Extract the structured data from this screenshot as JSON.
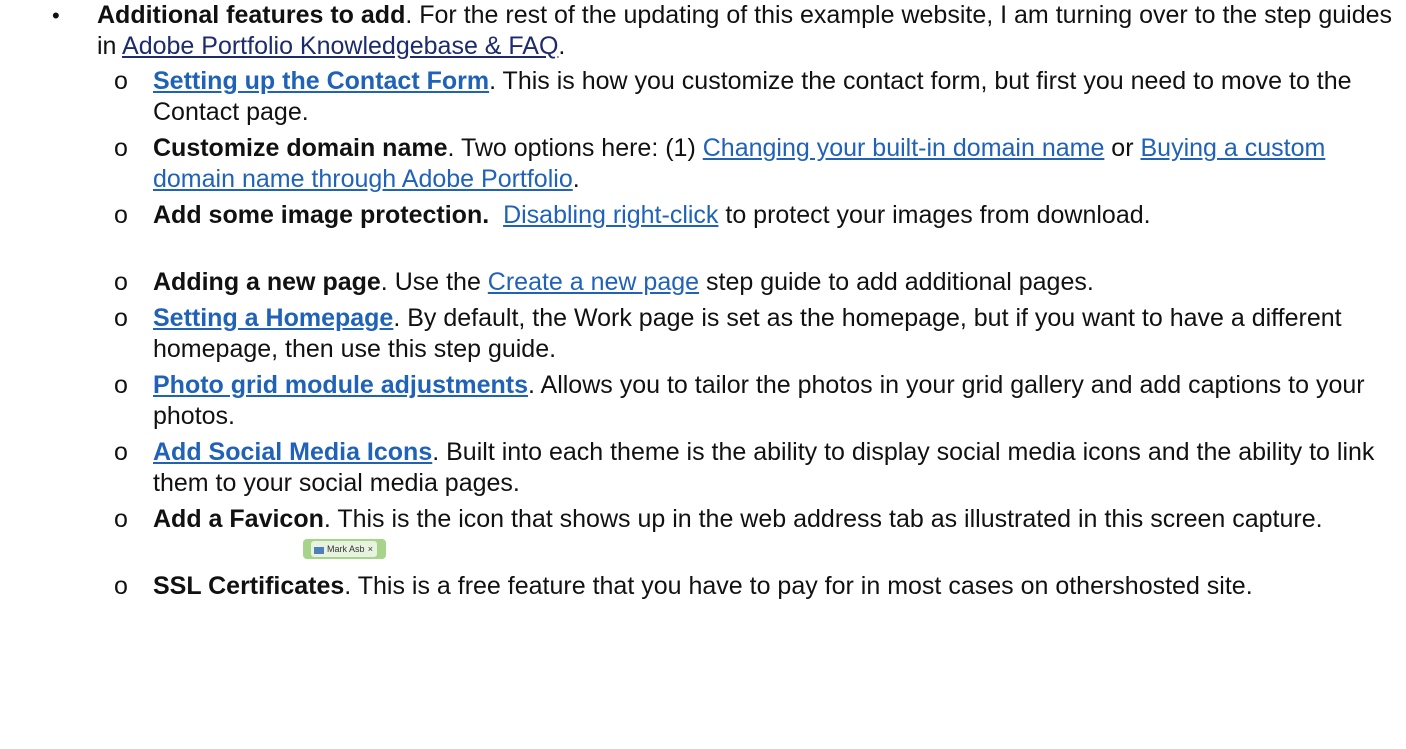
{
  "main_item": {
    "bullet": "•",
    "heading": "Additional features to add",
    "text_1": ".  For the rest of the updating of this example website, I am turning over to the step guides in ",
    "link": "Adobe Portfolio Knowledgebase & FAQ",
    "text_2": "."
  },
  "sub_bullet": "o",
  "items": [
    {
      "link": "Setting up the Contact Form",
      "text": ".  This is how you customize the contact form, but first you need to move to the Contact page."
    },
    {
      "heading": "Customize domain name",
      "text_1": ".  Two options here: (1) ",
      "link_1": "Changing your built-in domain name",
      "text_2": " or ",
      "link_2": "Buying a custom domain name through Adobe Portfolio",
      "text_3": "."
    },
    {
      "heading": "Add some image protection.",
      "text_1": "  ",
      "link": "Disabling right-click",
      "text_2": " to protect your images from download."
    },
    {
      "heading": "Adding a new page",
      "text_1": ".  Use the ",
      "link": "Create a new page",
      "text_2": " step guide to add additional pages."
    },
    {
      "link": "Setting a Homepage",
      "text": ".  By default, the Work page is set as the homepage, but if you want to have a different homepage, then use this step guide."
    },
    {
      "link": "Photo grid module adjustments",
      "text": ".  Allows you to tailor the photos in your grid gallery and add captions to your photos."
    },
    {
      "link": "Add Social Media Icons",
      "text": ".  Built into each theme is the ability to display social media icons and the ability to link them to your social media pages."
    },
    {
      "heading": "Add a Favicon",
      "text": ".  This is the icon that shows up in the web address tab as illustrated in this screen capture.",
      "tab_label": "Mark Asb",
      "tab_close": "×"
    },
    {
      "heading": "SSL Certificates",
      "text": ". This is a free feature that you have to pay for in most cases on othershosted site."
    }
  ],
  "colors": {
    "link": "#1f62b8",
    "link_dark": "#1c2b6e",
    "text": "#111111"
  }
}
